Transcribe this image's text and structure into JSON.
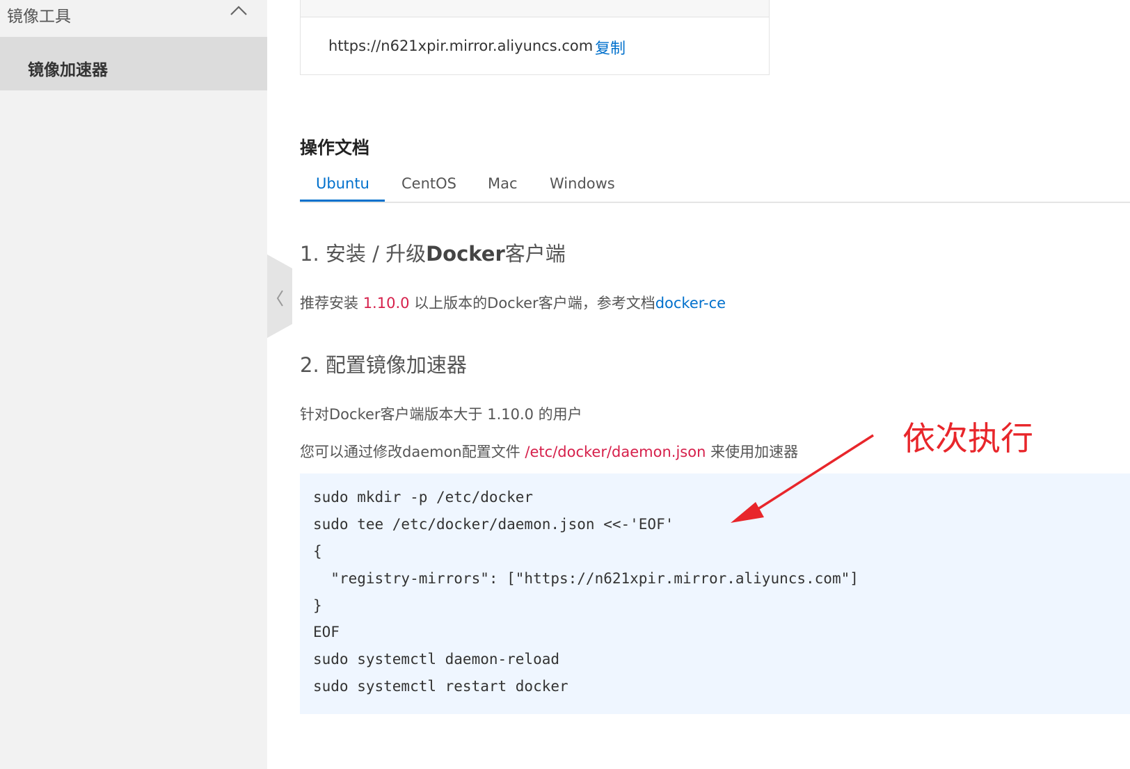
{
  "sidebar": {
    "group_title": "镜像工具",
    "active_item": "镜像加速器"
  },
  "mirror": {
    "url": "https://n621xpir.mirror.aliyuncs.com",
    "copy_label": "复制"
  },
  "docs": {
    "title": "操作文档",
    "tabs": [
      {
        "label": "Ubuntu",
        "active": true
      },
      {
        "label": "CentOS",
        "active": false
      },
      {
        "label": "Mac",
        "active": false
      },
      {
        "label": "Windows",
        "active": false
      }
    ],
    "step1": {
      "heading_prefix": "1. 安装 / 升级",
      "heading_bold": "Docker",
      "heading_suffix": "客户端",
      "text_prefix": "推荐安装 ",
      "version": "1.10.0",
      "text_middle": " 以上版本的Docker客户端，参考文档",
      "link": "docker-ce"
    },
    "step2": {
      "heading": "2. 配置镜像加速器",
      "line1": "针对Docker客户端版本大于 1.10.0 的用户",
      "line2_prefix": "您可以通过修改daemon配置文件 ",
      "line2_path": "/etc/docker/daemon.json",
      "line2_suffix": " 来使用加速器"
    },
    "code_lines": [
      "sudo mkdir -p /etc/docker",
      "sudo tee /etc/docker/daemon.json <<-'EOF'",
      "{",
      "  \"registry-mirrors\": [\"https://n621xpir.mirror.aliyuncs.com\"]",
      "}",
      "EOF",
      "sudo systemctl daemon-reload",
      "sudo systemctl restart docker"
    ]
  },
  "annotation": {
    "text": "依次执行",
    "color": "#e8262b"
  },
  "colors": {
    "accent": "#0070cc",
    "highlight": "#d6204b",
    "sidebar_bg": "#f2f2f2",
    "code_bg": "#eff6ff"
  }
}
